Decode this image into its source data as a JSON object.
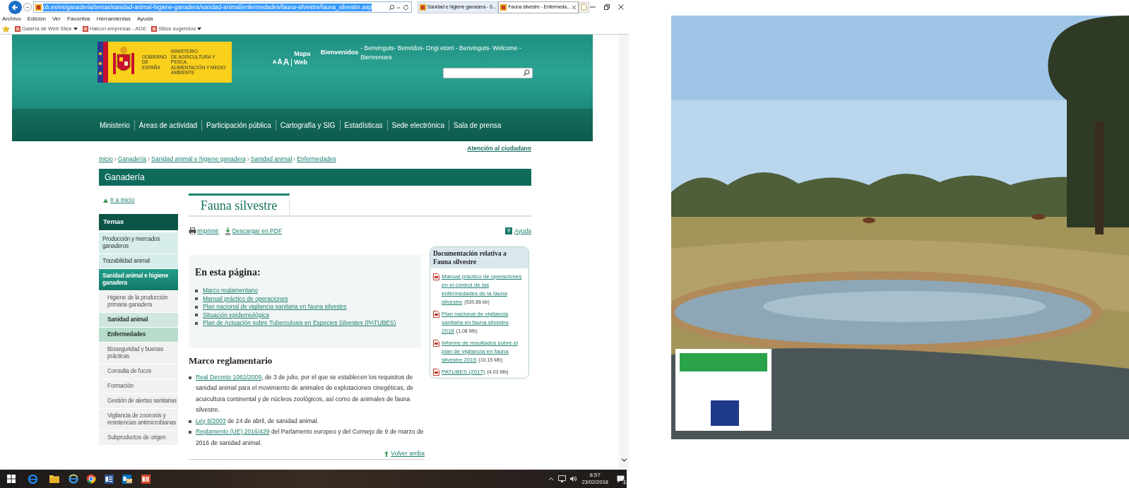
{
  "browser": {
    "address": "ob.es/es/ganaderia/temas/sanidad-animal-higiene-ganadera/sanidad-animal/enfermedades/fauna-silvestre/fauna_silvestre.asp",
    "address_selected": true,
    "tabs": [
      {
        "label": "Sanidad e higiene ganadera - S...",
        "selected": false
      },
      {
        "label": "Fauna silvestre - Enfermeda...",
        "selected": true
      }
    ],
    "menu": [
      "Archivo",
      "Edición",
      "Ver",
      "Favoritos",
      "Herramientas",
      "Ayuda"
    ],
    "favorites": [
      {
        "label": "Galería de Web Slice",
        "dropdown": true
      },
      {
        "label": "Halcon empresas - AGE",
        "dropdown": false
      },
      {
        "label": "Sitios sugeridos",
        "dropdown": true
      }
    ]
  },
  "header": {
    "government": "GOBIERNO\nDE ESPAÑA",
    "ministry": "MINISTERIO\nDE AGRICULTURA Y PESCA,\nALIMENTACIÓN Y MEDIO AMBIENTE",
    "font_sizes": [
      "A",
      "A",
      "A"
    ],
    "sitemap": "Mapa Web",
    "welcome": "Bienvenidos",
    "languages": "- Benvinguts- Benvidos- Ongi etorri - Benvinguts- Welcome - Bienvenues",
    "nav": [
      "Ministerio",
      "Áreas de actividad",
      "Participación pública",
      "Cartografía y SIG",
      "Estadísticas",
      "Sede electrónica",
      "Sala de prensa"
    ]
  },
  "page": {
    "service_link": "Atención al ciudadano",
    "breadcrumb": [
      "Inicio",
      "Ganadería",
      "Sanidad animal e higiene ganadera",
      "Sanidad animal",
      "Enfermedades"
    ],
    "section": "Ganadería",
    "sidebar": {
      "home_link": "Ir a Inicio",
      "heading": "Temas",
      "items": [
        {
          "label": "Producción y mercados ganaderos",
          "selected": false
        },
        {
          "label": "Trazabilidad animal",
          "selected": false
        },
        {
          "label": "Sanidad animal e higiene ganadera",
          "selected": true,
          "children": [
            {
              "label": "Higiene de la producción primaria ganadera",
              "selected": false
            },
            {
              "label": "Sanidad animal",
              "selected": true,
              "children": [
                {
                  "label": "Enfermedades",
                  "selected": true
                }
              ]
            },
            {
              "label": "Bioseguridad y buenas prácticas",
              "selected": false
            },
            {
              "label": "Consulta de focos",
              "selected": false
            },
            {
              "label": "Formación",
              "selected": false
            },
            {
              "label": "Gestión de alertas sanitarias",
              "selected": false
            },
            {
              "label": "Vigilancia de zoonosis y resistencias antimicrobianas",
              "selected": false
            },
            {
              "label": "Subproductos de origen",
              "selected": false
            }
          ]
        }
      ]
    },
    "title": "Fauna silvestre",
    "tools": [
      "Imprimir",
      "Descargar en PDF"
    ],
    "help_icon": "?",
    "help": "Ayuda",
    "toc": {
      "heading": "En esta página:",
      "links": [
        "Marco reglamentario",
        "Manual práctico de operaciones",
        "Plan nacional de vigilancia sanitaria en fauna silvestre",
        "Situación epidemiológica",
        "Plan de Actuación sobre Tuberculosis en Especies Silvestes (PATUBES)"
      ]
    },
    "regulation": {
      "heading": "Marco reglamentario",
      "items": [
        {
          "link": "Real Decreto 1082/2009",
          "text": ", de 3 de julio, por el que se establecen los requisitos de sanidad animal para el movimiento de animales de explotaciones cinegéticas, de acuicultura continental y de núcleos zoológicos, así como de animales de fauna silvestre."
        },
        {
          "link": "Ley 8/2003",
          "text": " de 24 de abril, de sanidad animal."
        },
        {
          "link": "Reglamento (UE) 2016/429",
          "text": " del Parlamento europeo y del Consejo de 9 de marzo de 2016 de sanidad animal."
        }
      ]
    },
    "back_to_top": "Volver arriba",
    "documents": {
      "heading": "Documentación relativa a Fauna silvestre",
      "items": [
        {
          "link": "Manual práctico de operaciones en el control de las enfermedades de la fauna silvestre",
          "size": "(530,86 kb)"
        },
        {
          "link": "Plan nacional de vigilancia sanitaria en fauna silvestre 2018",
          "size": "(1,08 Mb)"
        },
        {
          "link": "Informe de resultados sobre el plan de vigilancia en fauna silvestre 2015",
          "size": "(10,15 Mb)"
        },
        {
          "link": "PATUBES (2017)",
          "size": "(4,03 Mb)"
        }
      ]
    }
  },
  "taskbar": {
    "time": "8:57",
    "date": "23/02/2018",
    "notification_count": "1"
  }
}
